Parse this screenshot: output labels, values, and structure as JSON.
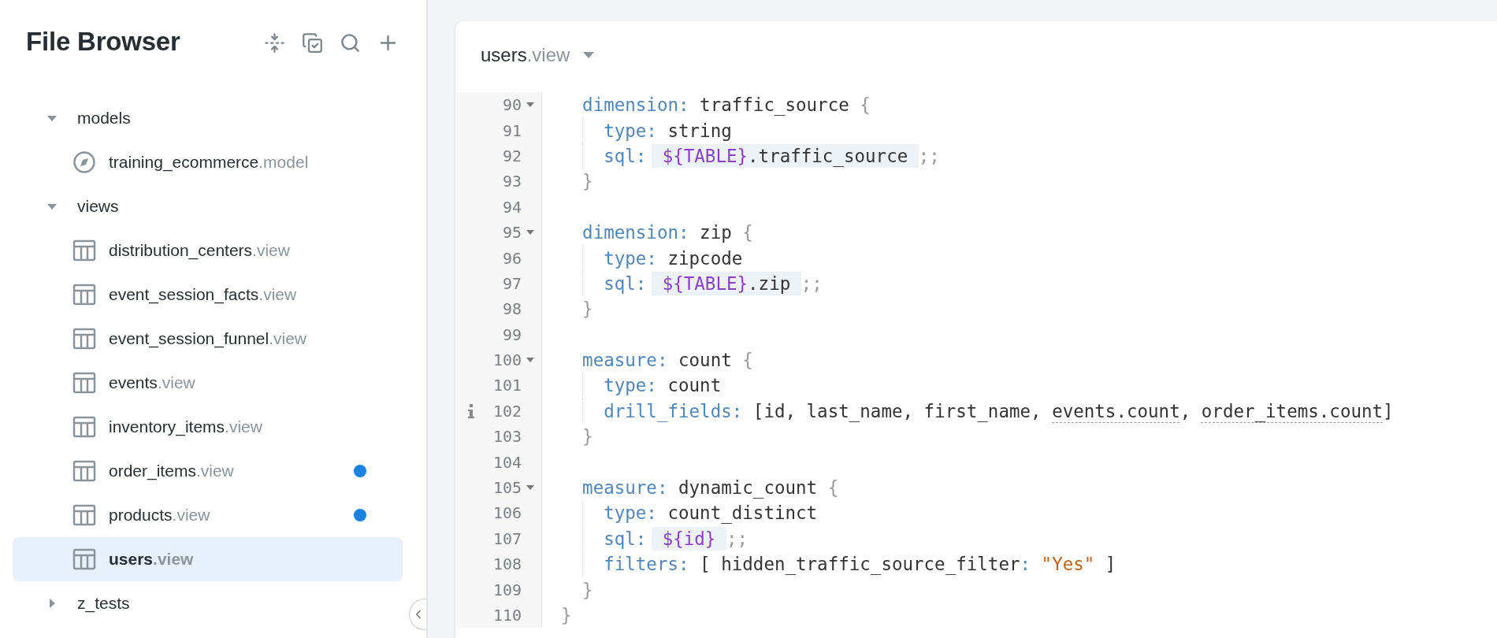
{
  "sidebar": {
    "title": "File Browser",
    "tree": [
      {
        "name": "models",
        "selected": false,
        "expanded": true,
        "children": [
          {
            "name": "training_ecommerce",
            "ext": ".model",
            "kind": "model",
            "selected": false,
            "modified": false
          }
        ]
      },
      {
        "name": "views",
        "selected": false,
        "expanded": true,
        "children": [
          {
            "name": "distribution_centers",
            "ext": ".view",
            "kind": "view",
            "selected": false,
            "modified": false
          },
          {
            "name": "event_session_facts",
            "ext": ".view",
            "kind": "view",
            "selected": false,
            "modified": false
          },
          {
            "name": "event_session_funnel",
            "ext": ".view",
            "kind": "view",
            "selected": false,
            "modified": false
          },
          {
            "name": "events",
            "ext": ".view",
            "kind": "view",
            "selected": false,
            "modified": false
          },
          {
            "name": "inventory_items",
            "ext": ".view",
            "kind": "view",
            "selected": false,
            "modified": false
          },
          {
            "name": "order_items",
            "ext": ".view",
            "kind": "view",
            "selected": false,
            "modified": true
          },
          {
            "name": "products",
            "ext": ".view",
            "kind": "view",
            "selected": false,
            "modified": true
          },
          {
            "name": "users",
            "ext": ".view",
            "kind": "view",
            "selected": true,
            "modified": false
          }
        ]
      },
      {
        "name": "z_tests",
        "selected": false,
        "expanded": false
      }
    ]
  },
  "editor": {
    "title": "users",
    "ext": ".view",
    "lines": [
      {
        "number": "90",
        "foldable": true,
        "info": false,
        "guide": false,
        "tokens": [
          {
            "kind": "keyword",
            "text": "  dimension:"
          },
          {
            "kind": "plain",
            "text": " traffic_source "
          },
          {
            "kind": "punct",
            "text": "{"
          }
        ]
      },
      {
        "number": "91",
        "foldable": false,
        "info": false,
        "guide": true,
        "tokens": [
          {
            "kind": "keyword",
            "text": "    type:"
          },
          {
            "kind": "plain",
            "text": " string"
          }
        ]
      },
      {
        "number": "92",
        "foldable": false,
        "info": false,
        "guide": true,
        "tokens": [
          {
            "kind": "keyword",
            "text": "    sql:"
          },
          {
            "kind": "sql",
            "parts": [
              {
                "kind": "variable",
                "text": "${TABLE}"
              },
              {
                "kind": "plain",
                "text": ".traffic_source"
              }
            ]
          },
          {
            "kind": "punct",
            "text": ";;"
          }
        ]
      },
      {
        "number": "93",
        "foldable": false,
        "info": false,
        "guide": false,
        "tokens": [
          {
            "kind": "punct",
            "text": "  }"
          }
        ]
      },
      {
        "number": "94",
        "foldable": false,
        "info": false,
        "guide": false
      },
      {
        "number": "95",
        "foldable": true,
        "info": false,
        "guide": false,
        "tokens": [
          {
            "kind": "keyword",
            "text": "  dimension:"
          },
          {
            "kind": "plain",
            "text": " zip "
          },
          {
            "kind": "punct",
            "text": "{"
          }
        ]
      },
      {
        "number": "96",
        "foldable": false,
        "info": false,
        "guide": true,
        "tokens": [
          {
            "kind": "keyword",
            "text": "    type:"
          },
          {
            "kind": "plain",
            "text": " zipcode"
          }
        ]
      },
      {
        "number": "97",
        "foldable": false,
        "info": false,
        "guide": true,
        "tokens": [
          {
            "kind": "keyword",
            "text": "    sql:"
          },
          {
            "kind": "sql",
            "parts": [
              {
                "kind": "variable",
                "text": "${TABLE}"
              },
              {
                "kind": "plain",
                "text": ".zip"
              }
            ]
          },
          {
            "kind": "punct",
            "text": ";;"
          }
        ]
      },
      {
        "number": "98",
        "foldable": false,
        "info": false,
        "guide": false,
        "tokens": [
          {
            "kind": "punct",
            "text": "  }"
          }
        ]
      },
      {
        "number": "99",
        "foldable": false,
        "info": false,
        "guide": false
      },
      {
        "number": "100",
        "foldable": true,
        "info": false,
        "guide": false,
        "tokens": [
          {
            "kind": "keyword",
            "text": "  measure:"
          },
          {
            "kind": "plain",
            "text": " count "
          },
          {
            "kind": "punct",
            "text": "{"
          }
        ]
      },
      {
        "number": "101",
        "foldable": false,
        "info": false,
        "guide": true,
        "tokens": [
          {
            "kind": "keyword",
            "text": "    type:"
          },
          {
            "kind": "plain",
            "text": " count"
          }
        ]
      },
      {
        "number": "102",
        "foldable": false,
        "info": true,
        "guide": true,
        "tokens": [
          {
            "kind": "keyword",
            "text": "    drill_fields:"
          },
          {
            "kind": "plain",
            "text": " [id, last_name, first_name, "
          },
          {
            "kind": "reference",
            "text": "events.count"
          },
          {
            "kind": "plain",
            "text": ", "
          },
          {
            "kind": "reference",
            "text": "order_items.count"
          },
          {
            "kind": "plain",
            "text": "]"
          }
        ]
      },
      {
        "number": "103",
        "foldable": false,
        "info": false,
        "guide": false,
        "tokens": [
          {
            "kind": "punct",
            "text": "  }"
          }
        ]
      },
      {
        "number": "104",
        "foldable": false,
        "info": false,
        "guide": false
      },
      {
        "number": "105",
        "foldable": true,
        "info": false,
        "guide": false,
        "tokens": [
          {
            "kind": "keyword",
            "text": "  measure:"
          },
          {
            "kind": "plain",
            "text": " dynamic_count "
          },
          {
            "kind": "punct",
            "text": "{"
          }
        ]
      },
      {
        "number": "106",
        "foldable": false,
        "info": false,
        "guide": true,
        "tokens": [
          {
            "kind": "keyword",
            "text": "    type:"
          },
          {
            "kind": "plain",
            "text": " count_distinct"
          }
        ]
      },
      {
        "number": "107",
        "foldable": false,
        "info": false,
        "guide": true,
        "tokens": [
          {
            "kind": "keyword",
            "text": "    sql:"
          },
          {
            "kind": "sql",
            "parts": [
              {
                "kind": "variable",
                "text": "${id}"
              }
            ]
          },
          {
            "kind": "punct",
            "text": ";;"
          }
        ]
      },
      {
        "number": "108",
        "foldable": false,
        "info": false,
        "guide": true,
        "tokens": [
          {
            "kind": "keyword",
            "text": "    filters:"
          },
          {
            "kind": "plain",
            "text": " [ hidden_traffic_source_filter"
          },
          {
            "kind": "keyword",
            "text": ":"
          },
          {
            "kind": "string",
            "text": " \"Yes\""
          },
          {
            "kind": "plain",
            "text": " ]"
          }
        ]
      },
      {
        "number": "109",
        "foldable": false,
        "info": false,
        "guide": false,
        "tokens": [
          {
            "kind": "punct",
            "text": "  }"
          }
        ]
      },
      {
        "number": "110",
        "foldable": false,
        "info": false,
        "guide": false,
        "tokens": [
          {
            "kind": "punct",
            "text": "}"
          }
        ]
      }
    ]
  }
}
